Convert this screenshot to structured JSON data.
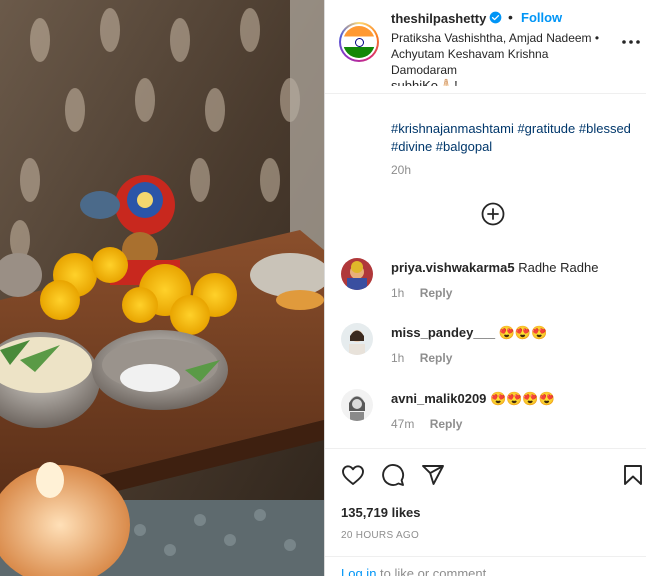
{
  "post": {
    "username": "theshilpashetty",
    "follow_label": "Follow",
    "audio_text": "Pratiksha Vashishtha, Amjad Nadeem • Achyutam Keshavam Krishna Damodaram",
    "caption_partial": "subhiKo🙏🏻!",
    "hashtags": "#krishnajanmashtami #gratitude #blessed #divine #balgopal",
    "caption_time": "20h",
    "likes": "135,719 likes",
    "post_time": "20 HOURS AGO"
  },
  "comments": [
    {
      "user": "priya.vishwakarma5",
      "text": "Radhe Radhe",
      "time": "1h",
      "reply": "Reply"
    },
    {
      "user": "miss_pandey___",
      "text": "😍😍😍",
      "time": "1h",
      "reply": "Reply"
    },
    {
      "user": "avni_malik0209",
      "text": "😍😍😍😍",
      "time": "47m",
      "reply": "Reply"
    }
  ],
  "login": {
    "link": "Log in",
    "rest": " to like or comment."
  },
  "icons": {
    "verified": "verified-badge-icon",
    "more": "more-options-icon",
    "load_more": "plus-circle-icon",
    "like": "heart-icon",
    "comment": "comment-icon",
    "share": "share-icon",
    "save": "bookmark-icon"
  },
  "colors": {
    "link_blue": "#0095f6",
    "hashtag": "#00376b",
    "muted": "#8e8e8e"
  }
}
